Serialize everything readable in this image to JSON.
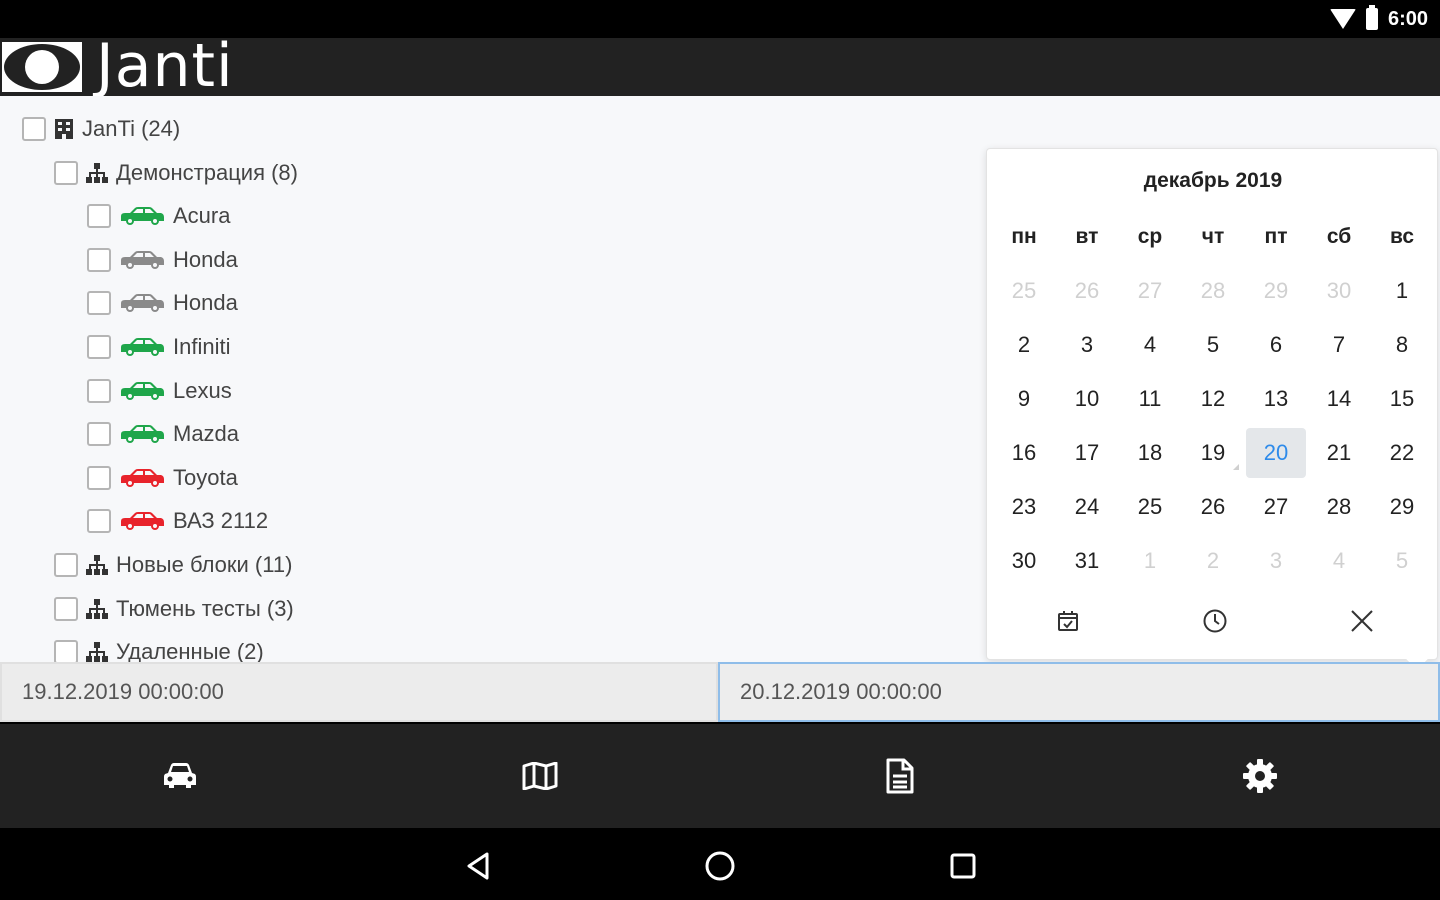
{
  "status": {
    "time": "6:00"
  },
  "app": {
    "title": "Janti"
  },
  "tree": [
    {
      "label": "JanTi (24)",
      "level": 0,
      "icon": "building-icon"
    },
    {
      "label": "Демонстрация (8)",
      "level": 1,
      "icon": "hierarchy-icon"
    },
    {
      "label": "Acura",
      "level": 2,
      "icon": "car-icon",
      "color": "#1fa64a"
    },
    {
      "label": "Honda",
      "level": 2,
      "icon": "car-icon",
      "color": "#8a8a8a"
    },
    {
      "label": "Honda",
      "level": 2,
      "icon": "car-icon",
      "color": "#8a8a8a"
    },
    {
      "label": "Infiniti",
      "level": 2,
      "icon": "car-icon",
      "color": "#1fa64a"
    },
    {
      "label": "Lexus",
      "level": 2,
      "icon": "car-icon",
      "color": "#1fa64a"
    },
    {
      "label": "Mazda",
      "level": 2,
      "icon": "car-icon",
      "color": "#1fa64a"
    },
    {
      "label": "Toyota",
      "level": 2,
      "icon": "car-icon",
      "color": "#e8232b"
    },
    {
      "label": "ВАЗ 2112",
      "level": 2,
      "icon": "car-icon",
      "color": "#e8232b"
    },
    {
      "label": "Новые блоки (11)",
      "level": 1,
      "icon": "hierarchy-icon"
    },
    {
      "label": "Тюмень тесты (3)",
      "level": 1,
      "icon": "hierarchy-icon"
    },
    {
      "label": "Удаленные (2)",
      "level": 1,
      "icon": "hierarchy-icon"
    }
  ],
  "calendar": {
    "month_label": "декабрь 2019",
    "weekdays": [
      "пн",
      "вт",
      "ср",
      "чт",
      "пт",
      "сб",
      "вс"
    ],
    "weeks": [
      [
        "25",
        "26",
        "27",
        "28",
        "29",
        "30",
        "1"
      ],
      [
        "2",
        "3",
        "4",
        "5",
        "6",
        "7",
        "8"
      ],
      [
        "9",
        "10",
        "11",
        "12",
        "13",
        "14",
        "15"
      ],
      [
        "16",
        "17",
        "18",
        "19",
        "20",
        "21",
        "22"
      ],
      [
        "23",
        "24",
        "25",
        "26",
        "27",
        "28",
        "29"
      ],
      [
        "30",
        "31",
        "1",
        "2",
        "3",
        "4",
        "5"
      ]
    ],
    "selected_day": "20",
    "today_day": "19"
  },
  "dates": {
    "from": "19.12.2019 00:00:00",
    "to": "20.12.2019 00:00:00"
  },
  "bottom_nav": [
    "car-icon",
    "map-icon",
    "report-icon",
    "settings-icon"
  ],
  "colors": {
    "accent": "#2e8bea",
    "car_online": "#1fa64a",
    "car_offline": "#8a8a8a",
    "car_alarm": "#e8232b"
  }
}
